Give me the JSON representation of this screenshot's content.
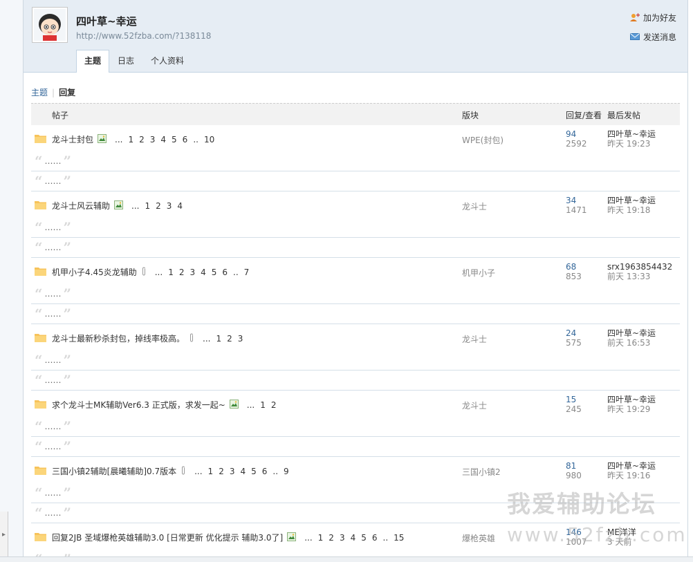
{
  "profile": {
    "name": "四叶草~幸运",
    "url": "http://www.52fzba.com/?138118"
  },
  "actions": [
    {
      "label": "加为好友",
      "icon": "add-friend-icon"
    },
    {
      "label": "发送消息",
      "icon": "envelope-icon"
    }
  ],
  "tabs": [
    {
      "label": "主题",
      "active": true
    },
    {
      "label": "日志",
      "active": false
    },
    {
      "label": "个人资料",
      "active": false
    }
  ],
  "subnav": {
    "topics": "主题",
    "replies": "回复"
  },
  "table_header": {
    "post": "帖子",
    "forum": "版块",
    "reply_view": "回复/查看",
    "last_post": "最后发帖"
  },
  "quote_text": "……",
  "rows": [
    {
      "title": "龙斗士封包",
      "icon": "image-attachment-icon",
      "pages": [
        "...",
        "1",
        "2",
        "3",
        "4",
        "5",
        "6",
        "..",
        "10"
      ],
      "forum": "WPE(封包)",
      "replies": "94",
      "views": "2592",
      "last_user": "四叶草~幸运",
      "last_time": "昨天 19:23"
    },
    {
      "title": "龙斗士风云辅助",
      "icon": "image-attachment-icon",
      "pages": [
        "...",
        "1",
        "2",
        "3",
        "4"
      ],
      "forum": "龙斗士",
      "replies": "34",
      "views": "1471",
      "last_user": "四叶草~幸运",
      "last_time": "昨天 19:18"
    },
    {
      "title": "机甲小子4.45炎龙辅助",
      "icon": "paperclip-icon",
      "pages": [
        "...",
        "1",
        "2",
        "3",
        "4",
        "5",
        "6",
        "..",
        "7"
      ],
      "forum": "机甲小子",
      "replies": "68",
      "views": "853",
      "last_user": "srx1963854432",
      "last_time": "前天 13:33"
    },
    {
      "title": "龙斗士最新秒杀封包，掉线率极高。",
      "icon": "paperclip-icon",
      "pages": [
        "...",
        "1",
        "2",
        "3"
      ],
      "forum": "龙斗士",
      "replies": "24",
      "views": "575",
      "last_user": "四叶草~幸运",
      "last_time": "前天 16:53"
    },
    {
      "title": "求个龙斗士MK辅助Ver6.3 正式版，求发一起~",
      "icon": "image-attachment-icon",
      "pages": [
        "...",
        "1",
        "2"
      ],
      "forum": "龙斗士",
      "replies": "15",
      "views": "245",
      "last_user": "四叶草~幸运",
      "last_time": "昨天 19:29"
    },
    {
      "title": "三国小镇2辅助[晨曦辅助]0.7版本",
      "icon": "paperclip-icon",
      "pages": [
        "...",
        "1",
        "2",
        "3",
        "4",
        "5",
        "6",
        "..",
        "9"
      ],
      "forum": "三国小镇2",
      "replies": "81",
      "views": "980",
      "last_user": "四叶草~幸运",
      "last_time": "昨天 19:16"
    },
    {
      "title": "回复2JB 圣域爆枪英雄辅助3.0 [日常更新 优化提示 辅助3.0了]",
      "icon": "image-attachment-icon",
      "pages": [
        "...",
        "1",
        "2",
        "3",
        "4",
        "5",
        "6",
        "..",
        "15"
      ],
      "forum": "爆枪英雄",
      "replies": "146",
      "views": "1007",
      "last_user": "ME洋洋",
      "last_time": "3 天前"
    }
  ],
  "watermark": {
    "line1": "我爱辅助论坛",
    "line2": "www.52fzb.com"
  }
}
